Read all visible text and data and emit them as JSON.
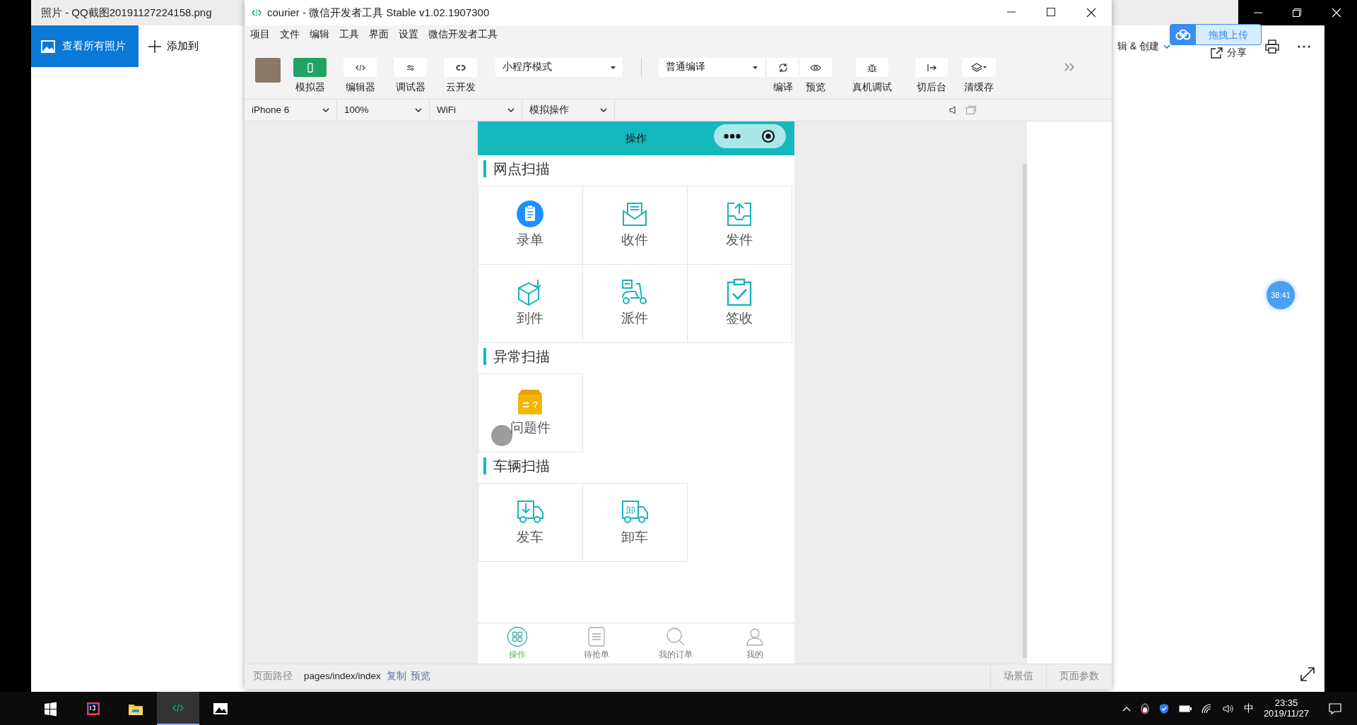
{
  "photos_app": {
    "title": "照片 - QQ截图20191127224158.png",
    "view_all_button": "查看所有照片",
    "add_button": "添加到",
    "edit_create_menu": "辑 & 创建",
    "share_button": "分享"
  },
  "upload_overlay": {
    "label": "拖拽上传"
  },
  "devtools": {
    "title": "courier - 微信开发者工具 Stable v1.02.1907300",
    "menu": [
      "项目",
      "文件",
      "编辑",
      "工具",
      "界面",
      "设置",
      "微信开发者工具"
    ],
    "view_toggles": [
      {
        "label": "模拟器",
        "selected": true
      },
      {
        "label": "编辑器",
        "selected": false
      },
      {
        "label": "调试器",
        "selected": false
      },
      {
        "label": "云开发",
        "selected": false
      }
    ],
    "mode_select": "小程序模式",
    "compile_select": "普通编译",
    "action_groups": [
      [
        "编译",
        "预览"
      ],
      [
        "真机调试"
      ],
      [
        "切后台"
      ],
      [
        "清缓存"
      ]
    ],
    "device_selects": [
      "iPhone 6",
      "100%",
      "WiFi",
      "模拟操作"
    ],
    "status_bar": {
      "path_label": "页面路径",
      "path": "pages/index/index",
      "copy_link": "复制",
      "preview_link": "预览",
      "scene_button": "场景值",
      "params_button": "页面参数"
    }
  },
  "phone": {
    "title": "操作",
    "sections": [
      {
        "title": "网点扫描",
        "items": [
          {
            "label": "录单",
            "touched": false
          },
          {
            "label": "收件",
            "touched": false
          },
          {
            "label": "发件",
            "touched": false
          },
          {
            "label": "到件",
            "touched": false
          },
          {
            "label": "派件",
            "touched": false
          },
          {
            "label": "签收",
            "touched": false
          }
        ]
      },
      {
        "title": "异常扫描",
        "items": [
          {
            "label": "问题件",
            "icon_text": "?",
            "touched": true
          }
        ]
      },
      {
        "title": "车辆扫描",
        "items": [
          {
            "label": "发车",
            "touched": false
          },
          {
            "label": "卸车",
            "icon_text": "卸",
            "touched": false
          }
        ]
      }
    ],
    "tabbar": [
      {
        "label": "操作",
        "selected": true
      },
      {
        "label": "待抢单",
        "selected": false
      },
      {
        "label": "我的订单",
        "selected": false
      },
      {
        "label": "我的",
        "selected": false
      }
    ]
  },
  "timer_badge": "38:41",
  "taskbar": {
    "apps": [
      {
        "selected": false
      },
      {
        "selected": false
      },
      {
        "selected": false
      },
      {
        "selected": true
      },
      {
        "selected": false
      }
    ],
    "ime": "中",
    "time": "23:35",
    "date": "2019/11/27"
  }
}
